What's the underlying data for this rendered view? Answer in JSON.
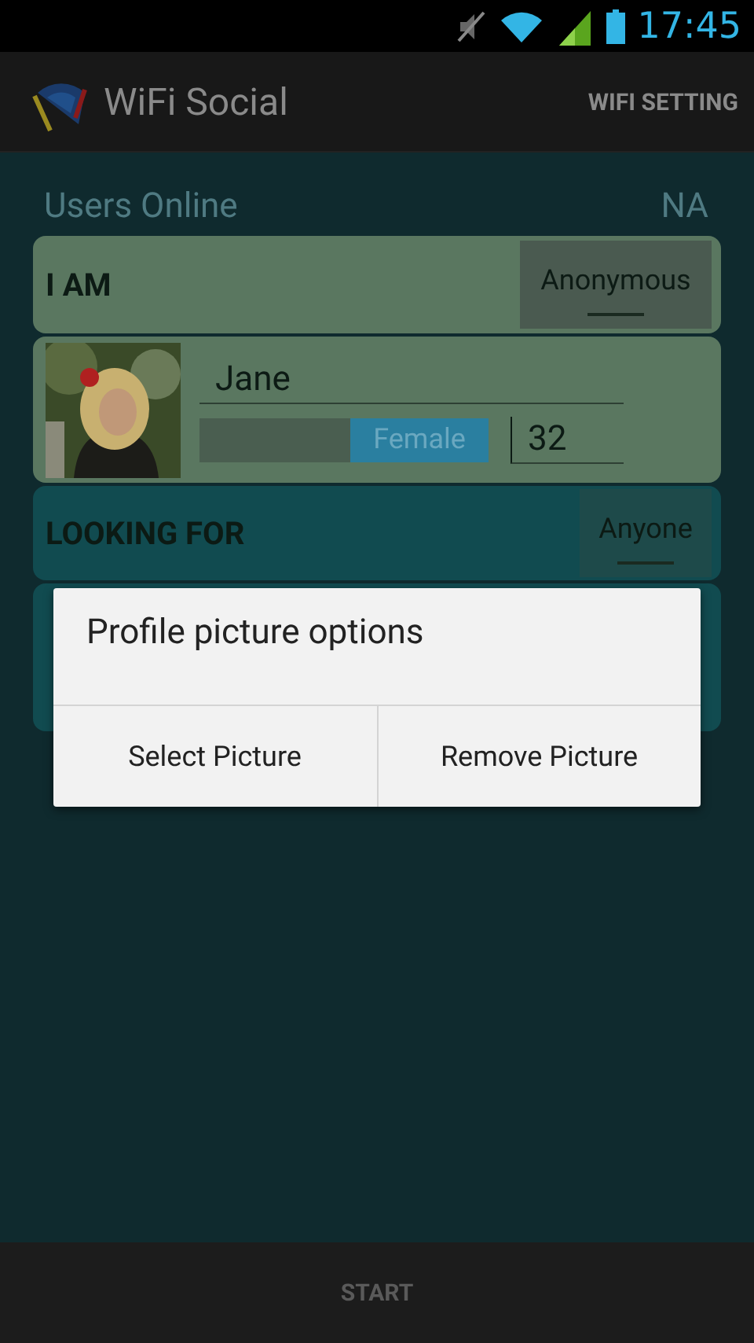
{
  "status_bar": {
    "time": "17:45"
  },
  "action_bar": {
    "title": "WiFi Social",
    "action": "WIFI SETTING"
  },
  "users_online": {
    "label": "Users Online",
    "value": "NA"
  },
  "i_am": {
    "label": "I AM",
    "spinner": "Anonymous"
  },
  "profile": {
    "name": "Jane",
    "gender_switch": {
      "label": "Female",
      "on": true
    },
    "age": "32"
  },
  "looking_for": {
    "label": "LOOKING FOR",
    "spinner": "Anyone"
  },
  "dialog": {
    "title": "Profile picture options",
    "buttons": [
      "Select Picture",
      "Remove Picture"
    ]
  },
  "bottom_bar": {
    "button": "START"
  }
}
